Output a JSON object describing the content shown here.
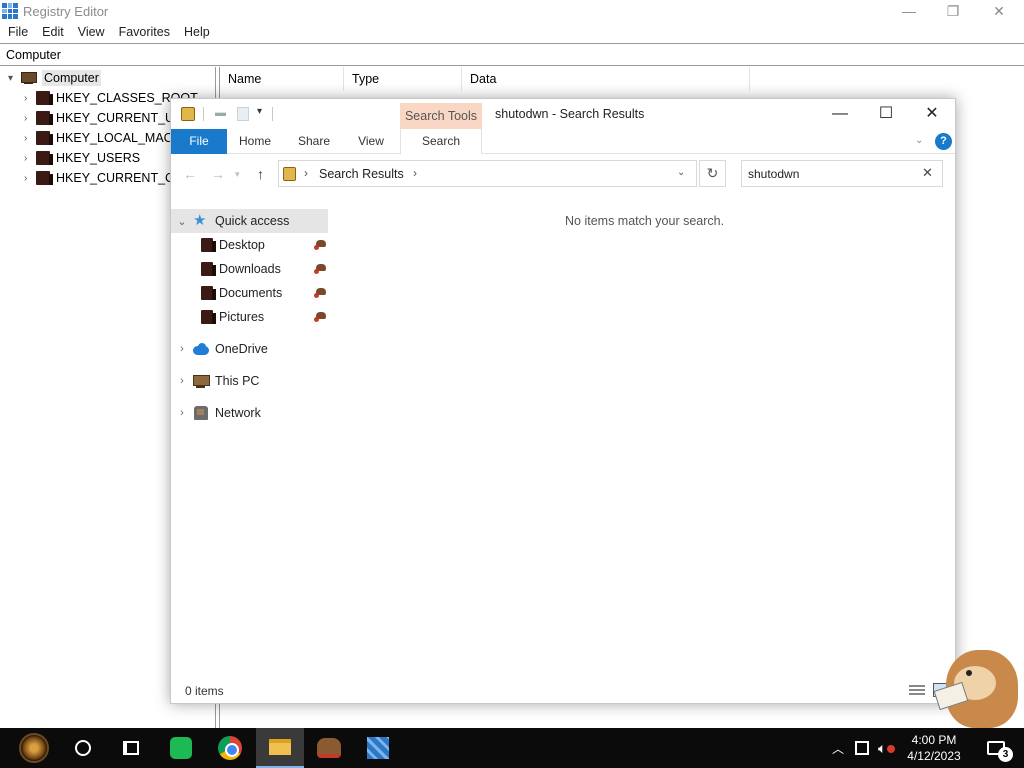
{
  "regedit": {
    "title": "Registry Editor",
    "menu": [
      "File",
      "Edit",
      "View",
      "Favorites",
      "Help"
    ],
    "address": "Computer",
    "tree": {
      "root": "Computer",
      "keys": [
        "HKEY_CLASSES_ROOT",
        "HKEY_CURRENT_U",
        "HKEY_LOCAL_MAC",
        "HKEY_USERS",
        "HKEY_CURRENT_C"
      ]
    },
    "columns": [
      "Name",
      "Type",
      "Data"
    ]
  },
  "explorer": {
    "context_tab_header": "Search Tools",
    "title": "shutodwn - Search Results",
    "tabs": {
      "file": "File",
      "home": "Home",
      "share": "Share",
      "view": "View",
      "search": "Search"
    },
    "address": {
      "location": "Search Results"
    },
    "search": {
      "value": "shutodwn"
    },
    "nav": {
      "quick_access": "Quick access",
      "pinned": [
        "Desktop",
        "Downloads",
        "Documents",
        "Pictures"
      ],
      "onedrive": "OneDrive",
      "this_pc": "This PC",
      "network": "Network"
    },
    "empty_message": "No items match your search.",
    "status": "0 items"
  },
  "taskbar": {
    "time": "4:00 PM",
    "date": "4/12/2023",
    "notification_count": "3"
  },
  "colors": {
    "accent": "#1979ca",
    "context_tab": "#fad7c4",
    "taskbar": "#0b0b0b"
  }
}
